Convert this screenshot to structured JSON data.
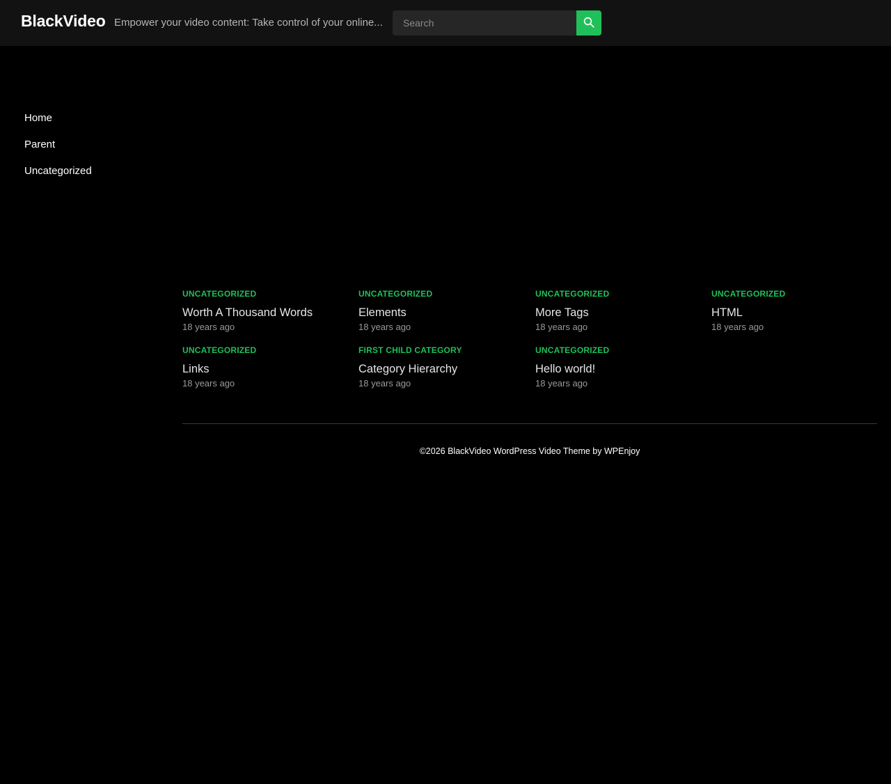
{
  "header": {
    "logo": "BlackVideo",
    "tagline": "Empower your video content: Take control of your online...",
    "search_placeholder": "Search",
    "search_icon": "search-icon",
    "accent_color": "#1fc05a"
  },
  "sidebar": {
    "items": [
      {
        "label": "Home"
      },
      {
        "label": "Parent"
      },
      {
        "label": "Uncategorized"
      }
    ]
  },
  "posts": [
    {
      "category": "Uncategorized",
      "title": "Worth A Thousand Words",
      "time": "18 years ago"
    },
    {
      "category": "Uncategorized",
      "title": "Elements",
      "time": "18 years ago"
    },
    {
      "category": "Uncategorized",
      "title": "More Tags",
      "time": "18 years ago"
    },
    {
      "category": "Uncategorized",
      "title": "HTML",
      "time": "18 years ago"
    },
    {
      "category": "Uncategorized",
      "title": "Links",
      "time": "18 years ago"
    },
    {
      "category": "First Child Category",
      "title": "Category Hierarchy",
      "time": "18 years ago"
    },
    {
      "category": "Uncategorized",
      "title": "Hello world!",
      "time": "18 years ago"
    }
  ],
  "footer": {
    "copyright": "©2026 BlackVideo WordPress Video Theme by WPEnjoy"
  }
}
